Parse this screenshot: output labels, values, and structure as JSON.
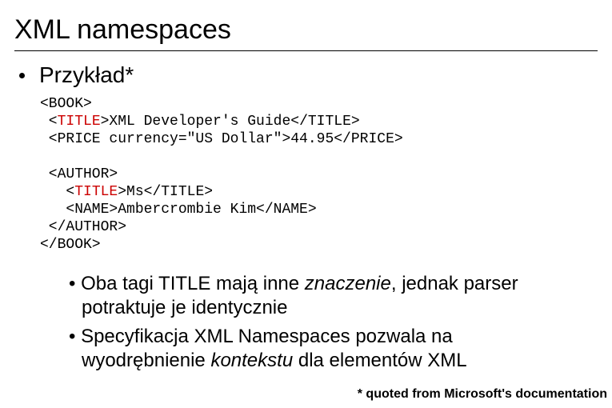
{
  "title": "XML namespaces",
  "subheading": "Przykład*",
  "code": {
    "l1a": "<BOOK>",
    "l2a": " <",
    "l2b": "TITLE",
    "l2c": ">XML Developer's Guide</TITLE>",
    "l3a": " <PRICE currency=\"US Dollar\">44.95</PRICE>",
    "blank1": "",
    "l4a": " <AUTHOR>",
    "l5a": "   <",
    "l5b": "TITLE",
    "l5c": ">Ms</TITLE>",
    "l6a": "   <NAME>Ambercrombie Kim</NAME>",
    "l7a": " </AUTHOR>",
    "l8a": "</BOOK>"
  },
  "bullets": {
    "b1a": "Oba tagi TITLE mają inne ",
    "b1b": "znaczenie",
    "b1c": ", jednak parser potraktuje je identycznie",
    "b2a": "Specyfikacja XML Namespaces pozwala na wyodrębnienie ",
    "b2b": "kontekstu",
    "b2c": " dla elementów XML"
  },
  "footnote": "* quoted from Microsoft's documentation"
}
